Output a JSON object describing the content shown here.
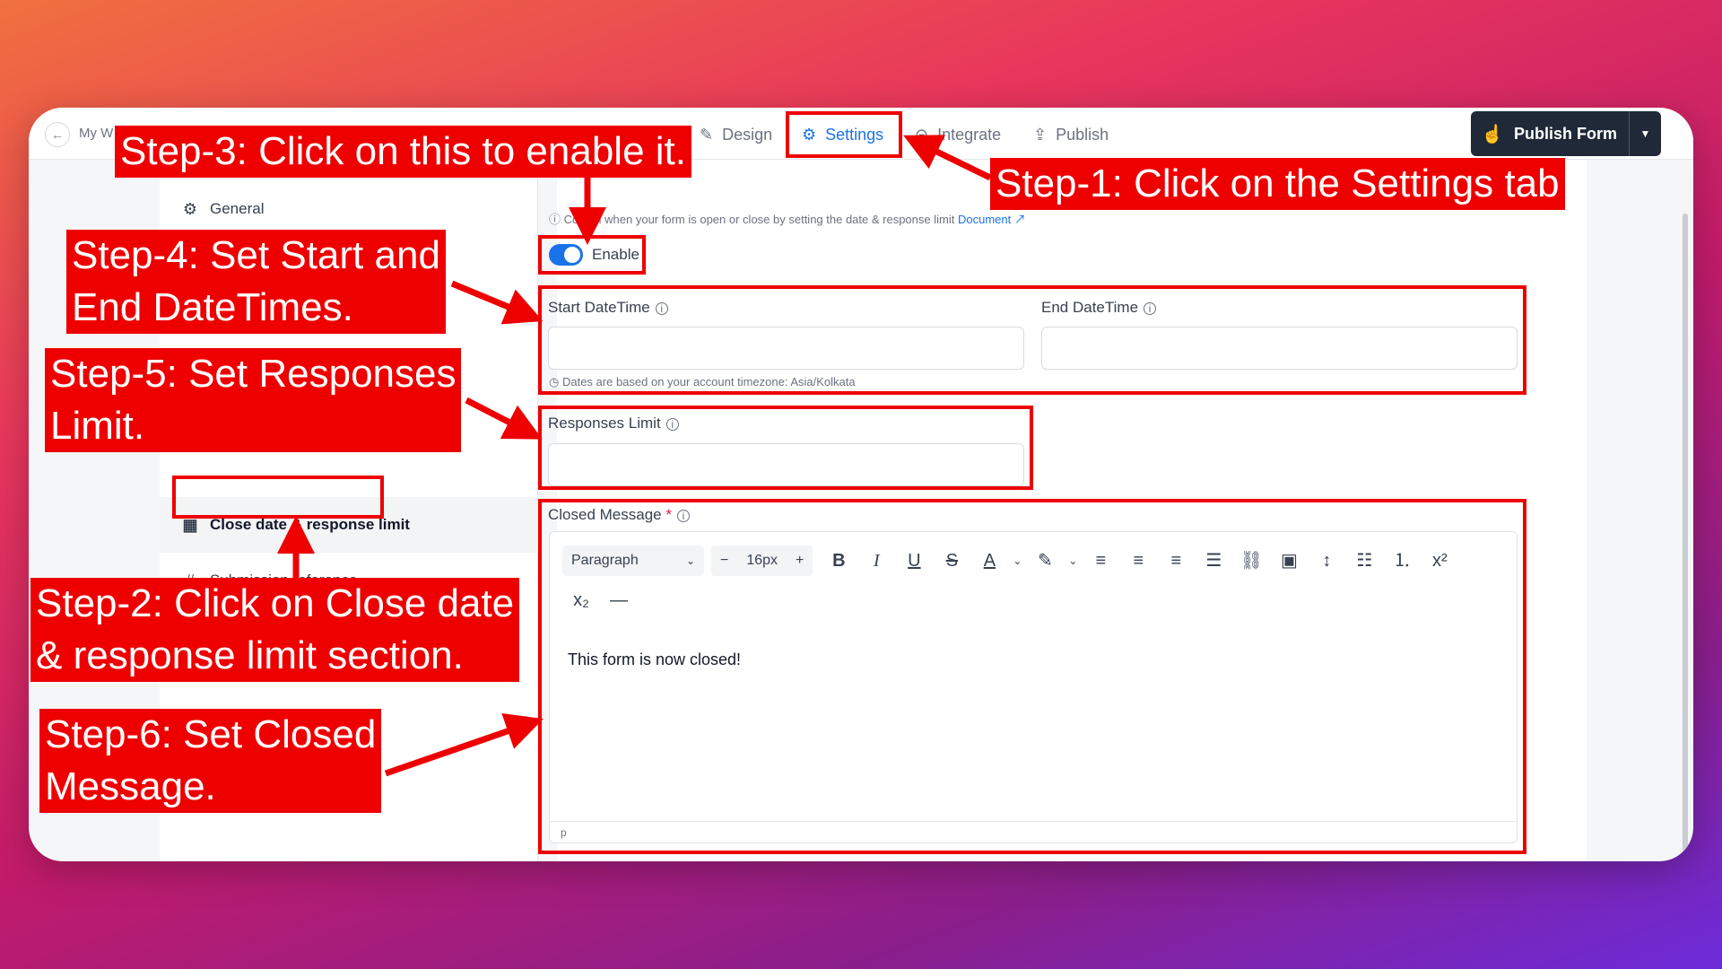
{
  "topbar": {
    "back_icon": "arrow-left-icon",
    "crumb": "My W",
    "tabs": [
      {
        "label": "Design",
        "icon": "brush-icon"
      },
      {
        "label": "Settings",
        "icon": "gear-icon"
      },
      {
        "label": "Integrate",
        "icon": "link-icon"
      },
      {
        "label": "Publish",
        "icon": "share-icon"
      }
    ],
    "publish_label": "Publish Form"
  },
  "sidebar": {
    "items": [
      {
        "label": "General",
        "icon": "gear-icon"
      },
      {
        "label": "Close date & response limit",
        "icon": "calendar-x-icon"
      },
      {
        "label": "Submission reference",
        "icon": "hash-icon"
      }
    ]
  },
  "settings": {
    "hint_text": "Control when your form is open or close by setting the date & response limit",
    "hint_link": "Document",
    "enable_label": "Enable",
    "enabled": true,
    "start_label": "Start DateTime",
    "end_label": "End DateTime",
    "start_value": "",
    "end_value": "",
    "timezone_note": "Dates are based on your account timezone: Asia/Kolkata",
    "responses_label": "Responses Limit",
    "responses_value": "",
    "closed_label": "Closed Message",
    "required_mark": "*",
    "editor": {
      "block_type": "Paragraph",
      "font_size": "16px",
      "content": "This form is now closed!",
      "footer": "p"
    }
  },
  "annotations": {
    "step1": "Step-1: Click on the Settings tab",
    "step2": "Step-2: Click on Close date\n& response limit section.",
    "step3": "Step-3: Click on this to enable it.",
    "step4": "Step-4: Set Start and\nEnd DateTimes.",
    "step5": "Step-5: Set Responses\nLimit.",
    "step6": "Step-6: Set Closed\nMessage."
  },
  "colors": {
    "accent": "#1a73e8",
    "annotation": "#ee0000",
    "publish_bg": "#1f2937"
  }
}
